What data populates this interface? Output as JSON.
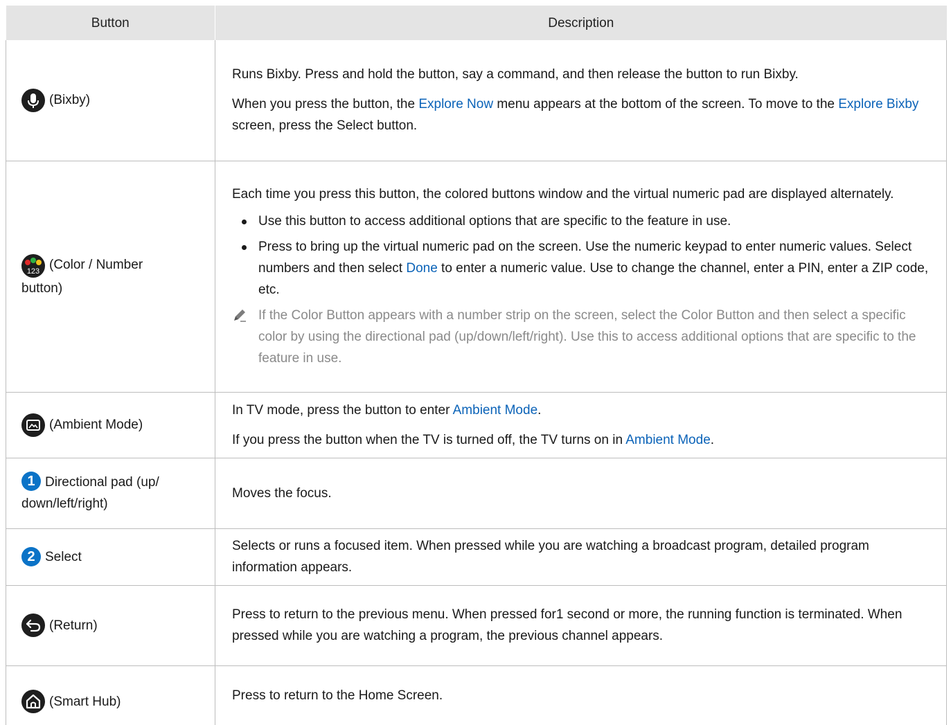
{
  "header": {
    "button": "Button",
    "description": "Description"
  },
  "rows": [
    {
      "icon": "microphone-icon",
      "label": "(Bixby)",
      "p1": "Runs Bixby. Press and hold the button, say a command, and then release the button to run Bixby.",
      "p2_a": "When you press the button, the ",
      "p2_link1": "Explore Now",
      "p2_b": " menu appears at the bottom of the screen. To move to the ",
      "p2_link2": "Explore Bixby",
      "p2_c": " screen, press the Select button."
    },
    {
      "icon": "color-number-icon",
      "label_l1": "(Color / Number",
      "label_l2": "button)",
      "p1": "Each time you press this button, the colored buttons window and the virtual numeric pad are displayed alternately.",
      "bullet1": "Use this button to access additional options that are specific to the feature in use.",
      "bullet2_a": "Press to bring up the virtual numeric pad on the screen. Use the numeric keypad to enter numeric values. Select numbers and then select ",
      "bullet2_link": "Done",
      "bullet2_b": " to enter a numeric value. Use to change the channel, enter a PIN, enter a ZIP code, etc.",
      "note": "If the Color Button appears with a number strip on the screen, select the Color Button and then select a specific color by using the directional pad (up/down/left/right). Use this to access additional options that are specific to the feature in use."
    },
    {
      "icon": "ambient-mode-icon",
      "label": "(Ambient Mode)",
      "p1_a": "In TV mode, press the button to enter ",
      "p1_link": "Ambient Mode",
      "p1_b": ".",
      "p2_a": "If you press the button when the TV is turned off, the TV turns on in ",
      "p2_link": "Ambient Mode",
      "p2_b": "."
    },
    {
      "number": "1",
      "label_l1": "Directional pad (up/",
      "label_l2": "down/left/right)",
      "p1": "Moves the focus."
    },
    {
      "number": "2",
      "label": "Select",
      "p1": "Selects or runs a focused item. When pressed while you are watching a broadcast program, detailed program information appears."
    },
    {
      "icon": "return-icon",
      "label": "(Return)",
      "p1": "Press to return to the previous menu. When pressed for1 second or more, the running function is terminated. When pressed while you are watching a program, the previous channel appears."
    },
    {
      "icon": "home-icon",
      "label": "(Smart Hub)",
      "p1": "Press to return to the Home Screen."
    }
  ],
  "colors": {
    "link": "#0b63b8",
    "number_badge": "#0b73c7",
    "header_bg": "#e4e4e4",
    "note_text": "#8a8a8a"
  }
}
